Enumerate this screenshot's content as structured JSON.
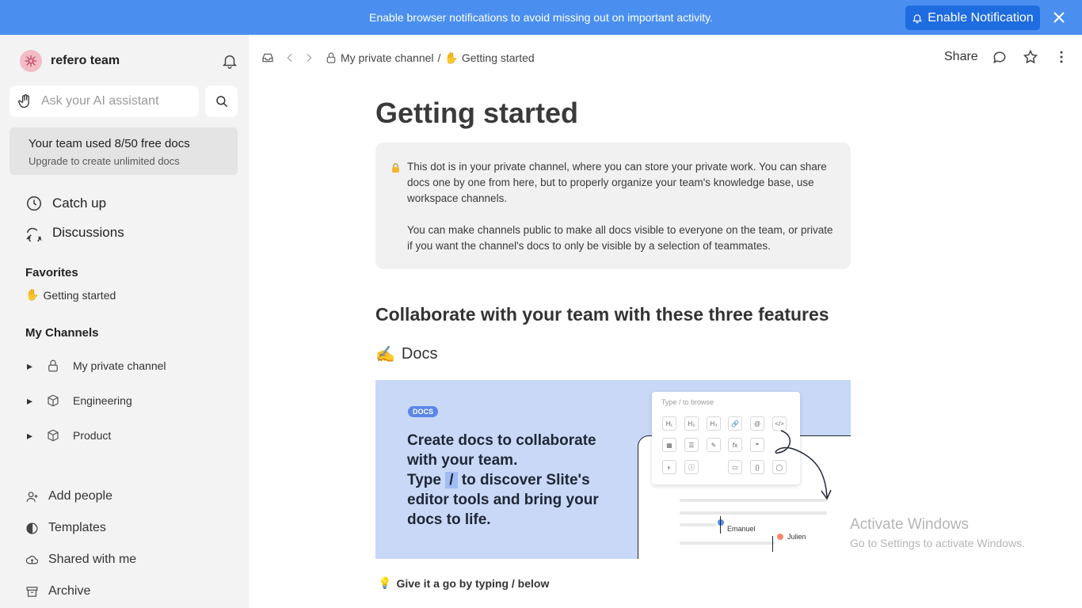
{
  "banner": {
    "text": "Enable browser notifications to avoid missing out on important activity.",
    "button_label": "Enable Notification",
    "bg_color": "#4a8ff0",
    "button_color": "#1f6be0"
  },
  "sidebar": {
    "team_name": "refero team",
    "ai_placeholder": "Ask your AI assistant",
    "usage_title": "Your team used 8/50 free docs",
    "usage_subtitle": "Upgrade to create unlimited docs",
    "nav": [
      {
        "label": "Catch up",
        "icon": "clock-icon"
      },
      {
        "label": "Discussions",
        "icon": "chat-bubbles-icon"
      }
    ],
    "favorites_title": "Favorites",
    "favorites": [
      {
        "label": "Getting started",
        "emoji": "✋"
      }
    ],
    "channels_title": "My Channels",
    "channels": [
      {
        "label": "My private channel",
        "icon": "lock-icon"
      },
      {
        "label": "Engineering",
        "icon": "cube-icon"
      },
      {
        "label": "Product",
        "icon": "cube-icon"
      }
    ],
    "bottom": [
      {
        "label": "Add people",
        "icon": "add-person-icon"
      },
      {
        "label": "Templates",
        "icon": "half-circle-icon"
      },
      {
        "label": "Shared with me",
        "icon": "cloud-icon"
      },
      {
        "label": "Archive",
        "icon": "archive-icon"
      }
    ]
  },
  "toolbar": {
    "breadcrumb_channel": "My private channel",
    "breadcrumb_sep": "/",
    "breadcrumb_doc": "Getting started",
    "breadcrumb_emoji": "✋",
    "share_label": "Share"
  },
  "doc": {
    "title": "Getting started",
    "callout_p1": "This dot is in your private channel, where you can store your private work. You can share docs one by one from here, but to properly organize your team's knowledge base, use workspace channels.",
    "callout_p2": "You can make channels public to make all docs visible to everyone on the team, or private if you want the channel's docs to only be visible by a selection of teammates.",
    "section_heading": "Collaborate with your team with these three features",
    "subsection_emoji": "✍️",
    "subsection_heading": "Docs",
    "hero": {
      "badge": "DOCS",
      "line1": "Create docs to collaborate",
      "line2": "with your team.",
      "line3_pre": "Type",
      "line3_slash": "/",
      "line3_post": "to discover Slite's",
      "line4": "editor tools and bring your",
      "line5": "docs to life.",
      "menu_placeholder": "Type / to browse",
      "tools_row1": [
        "H₁",
        "H₂",
        "H₃",
        "🔗",
        "@",
        "</>"
      ],
      "tools_row2": [
        "▦",
        "☰",
        "✎",
        "fx",
        "❝",
        ""
      ],
      "tools_row3": [
        "◐",
        "ⓘ",
        "",
        "▭",
        "{}",
        "◯"
      ],
      "user1": "Emanuel",
      "user2": "Julien",
      "bg_color": "#c8d8f6"
    },
    "tip_emoji": "💡",
    "tip": "Give it a go by typing / below"
  },
  "watermark": {
    "line1": "Activate Windows",
    "line2": "Go to Settings to activate Windows."
  }
}
